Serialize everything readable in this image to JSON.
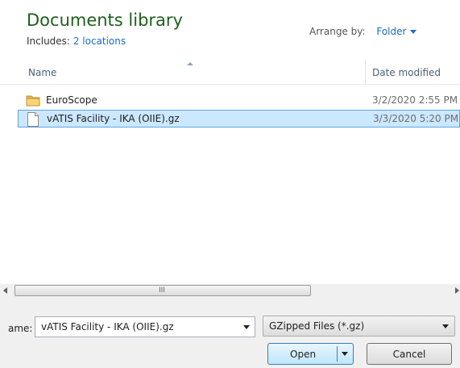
{
  "library": {
    "title": "Documents library",
    "includes_label": "Includes:",
    "includes_link": "2 locations",
    "arrange_label": "Arrange by:",
    "arrange_value": "Folder"
  },
  "columns": {
    "name": "Name",
    "date_modified": "Date modified"
  },
  "files": [
    {
      "name": "EuroScope",
      "date": "3/2/2020 2:55 PM",
      "icon": "folder-icon",
      "selected": false
    },
    {
      "name": "vATIS Facility - IKA (OIIE).gz",
      "date": "3/3/2020 5:20 PM",
      "icon": "file-icon",
      "selected": true
    }
  ],
  "scrollbar": {
    "grip": "III"
  },
  "footer": {
    "filename_label": "ame:",
    "filename_value": "vATIS Facility - IKA (OIIE).gz",
    "filter_value": "GZipped Files (*.gz)",
    "open_label": "Open",
    "cancel_label": "Cancel"
  },
  "colors": {
    "title": "#1e5f1c",
    "link": "#1a6bc9",
    "selection_bg": "#cce8ff",
    "selection_border": "#5aa6e6"
  }
}
